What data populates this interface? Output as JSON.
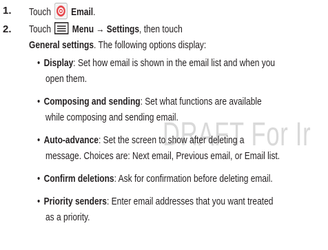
{
  "watermark": "DRAFT For Ir",
  "steps": [
    {
      "number": "1.",
      "parts": [
        "Touch",
        "Email",
        "."
      ]
    },
    {
      "number": "2.",
      "line1": [
        "Touch",
        "Menu → Settings",
        ", then touch"
      ],
      "line2": [
        "General settings",
        ". The following options display:"
      ]
    }
  ],
  "options": [
    {
      "term": "Display",
      "text1": ": Set how email is shown in the email list and when you",
      "text2": "open them."
    },
    {
      "term": "Composing and sending",
      "text1": ": Set what functions are available",
      "text2": "while composing and sending email."
    },
    {
      "term": "Auto-advance",
      "text1": ": Set the screen to show after deleting a",
      "text2": "message. Choices are: Next email, Previous email, or Email list."
    },
    {
      "term": "Confirm deletions",
      "text1": ": Ask for confirmation before deleting email."
    },
    {
      "term": "Priority senders",
      "text1": ": Enter email addresses that you want treated",
      "text2": "as a priority."
    }
  ],
  "bullet_char": "•",
  "icons": {
    "email": "email-app-icon",
    "menu": "menu-key-icon",
    "email_color": "#e6484d"
  }
}
